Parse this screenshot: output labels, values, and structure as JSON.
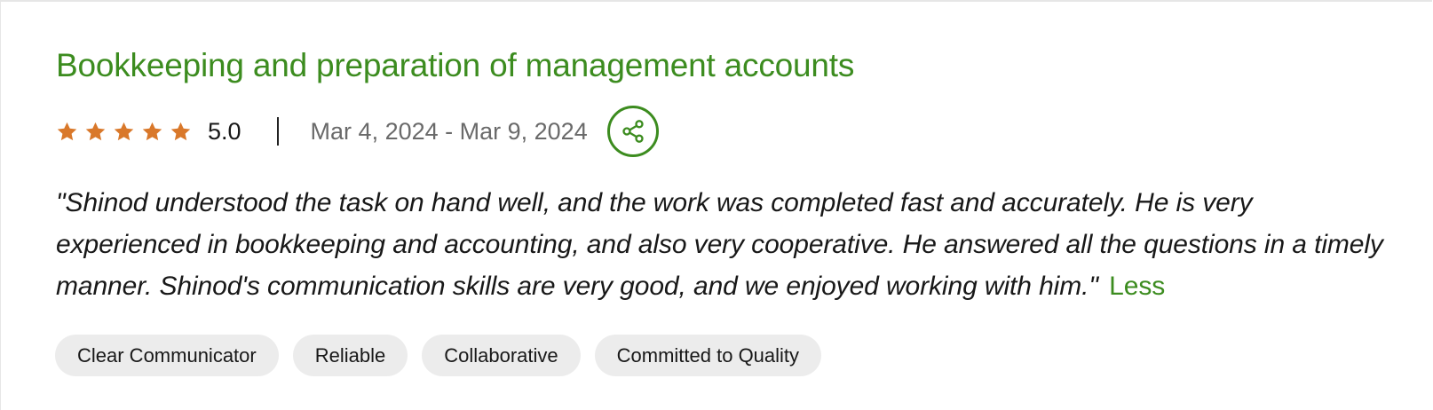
{
  "review": {
    "title": "Bookkeeping and preparation of management accounts",
    "rating_value": "5.0",
    "star_count": 5,
    "date_range": "Mar 4, 2024 - Mar 9, 2024",
    "quote": "\"Shinod understood the task on hand well, and the work was completed fast and accurately. He is very experienced in bookkeeping and accounting, and also very cooperative. He answered all the questions in a timely manner. Shinod's communication skills are very good, and we enjoyed working with him.\"",
    "less_label": "Less",
    "tags": [
      "Clear Communicator",
      "Reliable",
      "Collaborative",
      "Committed to Quality"
    ]
  },
  "icons": {
    "star": "star-icon",
    "share": "share-icon"
  },
  "colors": {
    "accent_green": "#3c8c1f",
    "star_orange": "#d9782a",
    "tag_bg": "#ececec",
    "date_gray": "#6a6a6a"
  }
}
